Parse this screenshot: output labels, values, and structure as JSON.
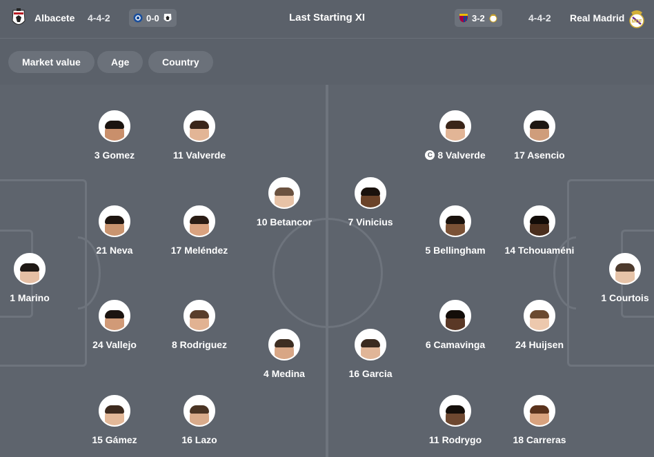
{
  "header": {
    "home": {
      "name": "Albacete",
      "formation": "4-4-2",
      "last_score": "0-0"
    },
    "title": "Last Starting XI",
    "away": {
      "name": "Real Madrid",
      "formation": "4-4-2",
      "last_score": "3-2"
    }
  },
  "filters": [
    "Market value",
    "Age",
    "Country"
  ],
  "colors": {
    "background": "#5b616a",
    "pitch": "#5e646d",
    "pitch_lines": "#6e747d",
    "pill": "#6b717a"
  },
  "home_players": [
    {
      "label": "3 Gomez",
      "skin": "#c98f6b",
      "hair": "#1b1410"
    },
    {
      "label": "11 Valverde",
      "skin": "#e2b596",
      "hair": "#3a2519"
    },
    {
      "label": "10 Betancor",
      "skin": "#e7c2a6",
      "hair": "#6b5240"
    },
    {
      "label": "21 Neva",
      "skin": "#c9946f",
      "hair": "#1e1510"
    },
    {
      "label": "17 Meléndez",
      "skin": "#d9a27f",
      "hair": "#2a1c14"
    },
    {
      "label": "1 Marino",
      "skin": "#e5bfa4",
      "hair": "#1f1915"
    },
    {
      "label": "24 Vallejo",
      "skin": "#d19a77",
      "hair": "#1c1410"
    },
    {
      "label": "8 Rodriguez",
      "skin": "#e1b292",
      "hair": "#5a3e2b"
    },
    {
      "label": "4 Medina",
      "skin": "#d8a685",
      "hair": "#3e2e22"
    },
    {
      "label": "15 Gámez",
      "skin": "#e3b898",
      "hair": "#3d2a1e"
    },
    {
      "label": "16 Lazo",
      "skin": "#d9ab8b",
      "hair": "#4a3424"
    }
  ],
  "away_players": [
    {
      "label": "8 Valverde",
      "captain": true,
      "skin": "#e2b596",
      "hair": "#3a2519"
    },
    {
      "label": "17 Asencio",
      "skin": "#cf9d7b",
      "hair": "#1e1712"
    },
    {
      "label": "7 Vinicius",
      "skin": "#6b4329",
      "hair": "#1a120d"
    },
    {
      "label": "5 Bellingham",
      "skin": "#7b5236",
      "hair": "#1a120d"
    },
    {
      "label": "14 Tchouaméni",
      "skin": "#4a2e1d",
      "hair": "#120c08"
    },
    {
      "label": "1 Courtois",
      "skin": "#e6c3a8",
      "hair": "#4d3a2d"
    },
    {
      "label": "16 Garcia",
      "skin": "#e0b597",
      "hair": "#3a2a1f"
    },
    {
      "label": "6 Camavinga",
      "skin": "#5a3826",
      "hair": "#130d09"
    },
    {
      "label": "24 Huijsen",
      "skin": "#ecc8ad",
      "hair": "#6b4a30"
    },
    {
      "label": "11 Rodrygo",
      "skin": "#6e4830",
      "hair": "#150f0a"
    },
    {
      "label": "18 Carreras",
      "skin": "#d8a27e",
      "hair": "#5a321c"
    }
  ]
}
